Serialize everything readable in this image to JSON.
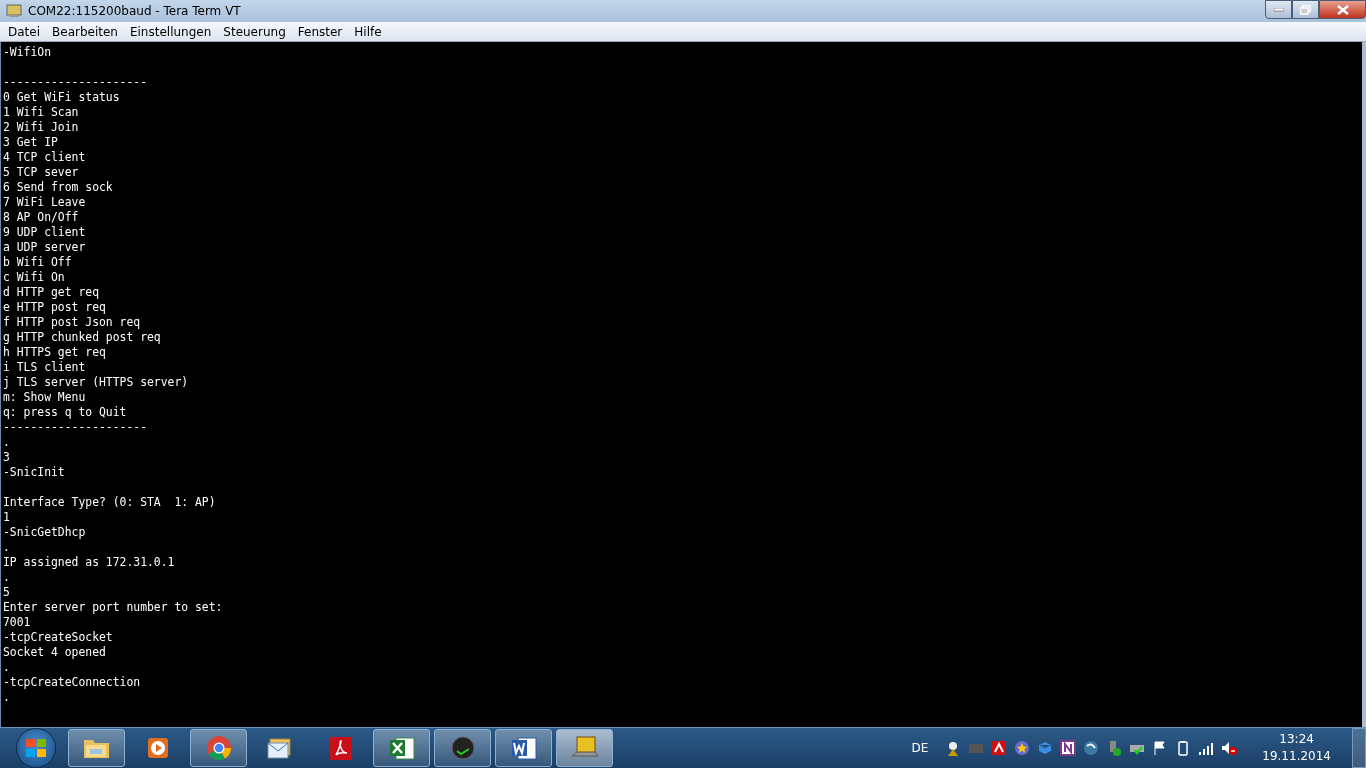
{
  "window": {
    "title": "COM22:115200baud - Tera Term VT"
  },
  "menu": [
    "Datei",
    "Bearbeiten",
    "Einstellungen",
    "Steuerung",
    "Fenster",
    "Hilfe"
  ],
  "terminal": {
    "blocks": [
      {
        "lines": [
          "-WifiOn"
        ]
      },
      {
        "lines": [
          "---------------------",
          "0 Get WiFi status",
          "1 Wifi Scan",
          "2 Wifi Join",
          "3 Get IP",
          "4 TCP client",
          "5 TCP sever",
          "6 Send from sock",
          "7 WiFi Leave",
          "8 AP On/Off",
          "9 UDP client",
          "a UDP server",
          "b Wifi Off",
          "c Wifi On",
          "d HTTP get req",
          "e HTTP post req",
          "f HTTP post Json req",
          "g HTTP chunked post req",
          "h HTTPS get req",
          "i TLS client",
          "j TLS server (HTTPS server)",
          "m: Show Menu",
          "q: press q to Quit",
          "---------------------",
          ".",
          "3",
          "-SnicInit"
        ]
      },
      {
        "lines": [
          "Interface Type? (0: STA  1: AP)",
          "1",
          "-SnicGetDhcp",
          ".",
          "IP assigned as 172.31.0.1",
          ".",
          "5",
          "Enter server port number to set:",
          "7001",
          "-tcpCreateSocket",
          "Socket 4 opened",
          ".",
          "-tcpCreateConnection",
          "."
        ]
      }
    ]
  },
  "taskbar": {
    "apps": [
      {
        "kind": "folder",
        "running": true,
        "selected": false
      },
      {
        "kind": "media",
        "running": false,
        "selected": false
      },
      {
        "kind": "chrome",
        "running": true,
        "selected": false
      },
      {
        "kind": "mail",
        "running": false,
        "selected": false
      },
      {
        "kind": "pdf",
        "running": false,
        "selected": false
      },
      {
        "kind": "excel",
        "running": true,
        "selected": false
      },
      {
        "kind": "ball",
        "running": true,
        "selected": false
      },
      {
        "kind": "word",
        "running": true,
        "selected": false
      },
      {
        "kind": "terminal",
        "running": true,
        "selected": true
      }
    ],
    "language": "DE",
    "time": "13:24",
    "date": "19.11.2014"
  }
}
